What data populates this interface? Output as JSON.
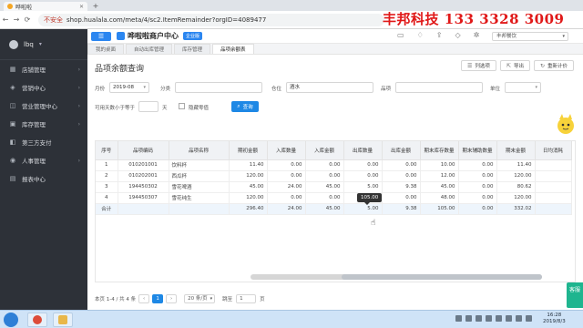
{
  "browser": {
    "tab_title": "哗啦啦",
    "new_tab": "+",
    "nav": [
      "←",
      "→",
      "⟳"
    ],
    "insecure_label": "不安全",
    "url": "shop.hualala.com/meta/4/sc2.ItemRemainder?orgID=4089477"
  },
  "watermark": "丰邦科技 133 3328 3009",
  "sidebar": {
    "user_name": "lbq",
    "items": [
      {
        "label": "店铺管理",
        "icon": "store-icon"
      },
      {
        "label": "营销中心",
        "icon": "megaphone-icon"
      },
      {
        "label": "营业管理中心",
        "icon": "briefcase-icon"
      },
      {
        "label": "库存管理",
        "icon": "box-icon"
      },
      {
        "label": "第三方支付",
        "icon": "wallet-icon"
      },
      {
        "label": "人事管理",
        "icon": "people-icon"
      },
      {
        "label": "报表中心",
        "icon": "chart-icon"
      }
    ]
  },
  "header": {
    "menu_glyph": "☰",
    "brand": "哗啦啦商户中心",
    "brand_tag": "企业版",
    "store_select": "丰邦餐饮",
    "icons": [
      "monitor-icon",
      "bell-icon",
      "upload-icon",
      "layers-icon",
      "gear-icon"
    ]
  },
  "tabs": [
    "我的桌面",
    "自动出库管理",
    "库存管理",
    "品项余额表"
  ],
  "page": {
    "title": "品项余额查询",
    "buttons": {
      "columns": "列选项",
      "export": "导出",
      "reset": "重新计价"
    }
  },
  "filters": {
    "month_label": "月份",
    "month_value": "2019-08",
    "category_label": "分类",
    "category_value": "",
    "warehouse_label": "仓位",
    "warehouse_value": "酒水",
    "item_label": "品项",
    "item_value": "",
    "unit_label": "单位",
    "unit_value": "",
    "days_label": "可用天数小于等于",
    "days_value": "",
    "days_unit": "天",
    "hide_zero_label": "隐藏零值",
    "search_label": "查询"
  },
  "table": {
    "headers": [
      "序号",
      "品项编码",
      "品项名称",
      "期初金额",
      "入库数量",
      "入库金额",
      "出库数量",
      "出库金额",
      "期末库存数量",
      "期末辅助数量",
      "期末金额",
      "日均消耗"
    ],
    "rows": [
      [
        "1",
        "010201001",
        "饮料杯",
        "11.40",
        "0.00",
        "0.00",
        "0.00",
        "0.00",
        "10.00",
        "0.00",
        "11.40",
        ""
      ],
      [
        "2",
        "010202001",
        "西瓜杯",
        "120.00",
        "0.00",
        "0.00",
        "0.00",
        "0.00",
        "12.00",
        "0.00",
        "120.00",
        ""
      ],
      [
        "3",
        "194450302",
        "雪花啤酒",
        "45.00",
        "24.00",
        "45.00",
        "5.00",
        "9.38",
        "45.00",
        "0.00",
        "80.62",
        ""
      ],
      [
        "4",
        "194450307",
        "雪花纯生",
        "120.00",
        "0.00",
        "0.00",
        "0.00",
        "0.00",
        "48.00",
        "0.00",
        "120.00",
        ""
      ]
    ],
    "total": [
      "合计",
      "",
      "",
      "296.40",
      "24.00",
      "45.00",
      "5.00",
      "9.38",
      "105.00",
      "0.00",
      "332.02",
      ""
    ]
  },
  "tooltip": "105.00",
  "pager": {
    "summary": "本页 1-4 / 共 4 条",
    "prev": "‹",
    "page": "1",
    "next": "›",
    "size": "20 条/页",
    "jump_label": "跳至",
    "jump_value": "1",
    "jump_unit": "页"
  },
  "float_button": "客服",
  "clock": {
    "time": "16:28",
    "date": "2019/8/3"
  }
}
